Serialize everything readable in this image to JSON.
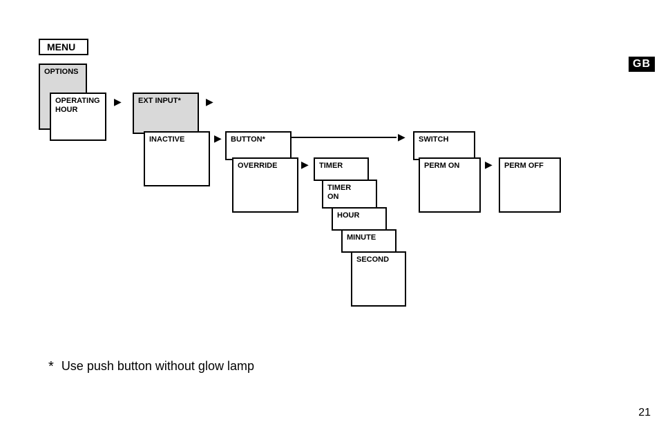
{
  "badge": "GB",
  "menu": "MENU",
  "options": "OPTIONS",
  "operating_hour_l1": "OPERATING",
  "operating_hour_l2": "HOUR",
  "ext_input": "EXT INPUT*",
  "inactive": "INACTIVE",
  "button": "BUTTON*",
  "override": "OVERRIDE",
  "timer": "TIMER",
  "timer_on_l1": "TIMER",
  "timer_on_l2": "ON",
  "hour": "HOUR",
  "minute": "MINUTE",
  "second": "SECOND",
  "switch": "SWITCH",
  "perm_on": "PERM ON",
  "perm_off": "PERM OFF",
  "footnote_star": "*",
  "footnote_text": "Use push button without glow lamp",
  "page_number": "21"
}
